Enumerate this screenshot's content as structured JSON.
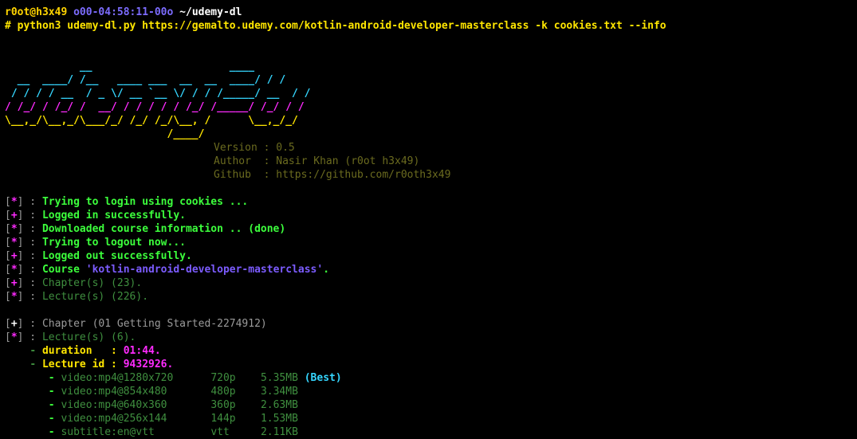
{
  "prompt": {
    "user": "r0ot@h3x49",
    "time": "o00-04:58:11-00o",
    "path": "~/udemy-dl"
  },
  "command": "# python3 udemy-dl.py https://gemalto.udemy.com/kotlin-android-developer-masterclass -k cookies.txt --info",
  "banner_lines": [
    "            __                      ____",
    "  __  ____/ /__   ____ ___  __  __  ____/ / /",
    " / / / / __  / _ \\/ __ `__ \\/ / / /_____/ __  / /",
    "/ /_/ / /_/ /  __/ / / / / / /_/ /_____/ /_/ / /",
    "\\__,_/\\__,_/\\___/_/ /_/ /_/\\__, /      \\__,_/_/",
    "                          /____/"
  ],
  "info": {
    "version_label": "Version",
    "version": "0.5",
    "author_label": "Author ",
    "author": "Nasir Khan (r0ot h3x49)",
    "github_label": "Github ",
    "github": "https://github.com/r0oth3x49"
  },
  "status_lines": [
    {
      "sym": "*",
      "text": "Trying to login using cookies ..."
    },
    {
      "sym": "+",
      "text": "Logged in successfully."
    },
    {
      "sym": "*",
      "text": "Downloaded course information .. (done)"
    },
    {
      "sym": "*",
      "text": "Trying to logout now..."
    },
    {
      "sym": "+",
      "text": "Logged out successfully."
    },
    {
      "sym": "*",
      "text": "Course ",
      "course": "'kotlin-android-developer-masterclass'",
      "tail": "."
    },
    {
      "sym": "+",
      "text": "Chapter(s) (23)."
    },
    {
      "sym": "*",
      "text": "Lecture(s) (226)."
    }
  ],
  "chapter": {
    "sym": "+",
    "text": "Chapter (01 Getting Started-2274912)",
    "lectures_sym": "*",
    "lectures_text": "Lecture(s) (6)."
  },
  "duration": {
    "label": "duration   :",
    "value": "01:44."
  },
  "lecture_id": {
    "label": "Lecture id :",
    "value": "9432926."
  },
  "streams": [
    {
      "name": "video:mp4@1280x720",
      "q": "720p",
      "size": "5.35MB",
      "best": "(Best)"
    },
    {
      "name": "video:mp4@854x480",
      "q": "480p",
      "size": "3.34MB",
      "best": ""
    },
    {
      "name": "video:mp4@640x360",
      "q": "360p",
      "size": "2.63MB",
      "best": ""
    },
    {
      "name": "video:mp4@256x144",
      "q": "144p",
      "size": "1.53MB",
      "best": ""
    },
    {
      "name": "subtitle:en@vtt",
      "q": "vtt",
      "size": "2.11KB",
      "best": ""
    }
  ],
  "colors": {
    "background": "#000000",
    "banner_cyan": "#35d6ff",
    "banner_magenta": "#ff2bff",
    "banner_yellow": "#ffe600",
    "success_green": "#3cff3c"
  }
}
